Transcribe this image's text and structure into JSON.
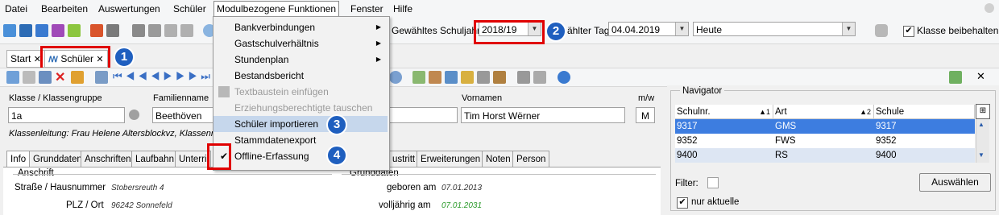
{
  "menu": {
    "items": [
      "Datei",
      "Bearbeiten",
      "Auswertungen",
      "Schüler",
      "Modulbezogene Funktionen",
      "Fenster",
      "Hilfe"
    ]
  },
  "toolbar": {
    "schoolyear_label": "Gewähltes Schuljahr",
    "schoolyear_value": "2018/19",
    "day_label": "ählter Tag",
    "day_value": "04.04.2019",
    "heute_value": "Heute",
    "klasse_checkbox_label": "Klasse beibehalten"
  },
  "doc_tabs": [
    {
      "label": "Start"
    },
    {
      "label": "Schüler"
    }
  ],
  "dropdown": {
    "items": [
      {
        "label": "Bankverbindungen",
        "submenu": true,
        "disabled": false
      },
      {
        "label": "Gastschulverhältnis",
        "submenu": true,
        "disabled": false
      },
      {
        "label": "Stundenplan",
        "submenu": true,
        "disabled": false
      },
      {
        "label": "Bestandsbericht",
        "submenu": false,
        "disabled": false
      },
      {
        "label": "Textbaustein einfügen",
        "submenu": false,
        "disabled": true
      },
      {
        "label": "Erziehungsberechtigte tauschen",
        "submenu": false,
        "disabled": true
      },
      {
        "label": "Schüler importieren",
        "submenu": false,
        "disabled": false,
        "highlighted": true
      },
      {
        "label": "Stammdatenexport",
        "submenu": false,
        "disabled": false
      },
      {
        "label": "Offline-Erfassung",
        "submenu": false,
        "disabled": false,
        "checked": true
      }
    ]
  },
  "badges": [
    "1",
    "2",
    "3",
    "4"
  ],
  "student": {
    "klasse_label": "Klasse / Klassengruppe",
    "klasse_value": "1a",
    "familienname_label": "Familienname",
    "familienname_value": "Beethöven",
    "vornamen_label": "Vornamen",
    "vornamen_value": "Tim Horst Wërner",
    "mw_label": "m/w",
    "mw_value": "M",
    "klassenleitung": "Klassenleitung: Frau Helene Altersblockvz, Klassenraum"
  },
  "subtabs": [
    "Info",
    "Grunddaten",
    "Anschriften",
    "Laufbahn",
    "Unterri",
    "ustritt",
    "Erweiterungen",
    "Noten",
    "Person"
  ],
  "info": {
    "anschrift_title": "Anschrift",
    "grunddaten_title": "Grunddaten",
    "strasse_label": "Straße / Hausnummer",
    "strasse_value": "Stobersreuth 4",
    "plz_label": "PLZ / Ort",
    "plz_value": "96242 Sonnefeld",
    "geboren_label": "geboren am",
    "geboren_value": "07.01.2013",
    "volljaehrig_label": "volljährig am",
    "volljaehrig_value": "07.01.2031"
  },
  "navigator": {
    "title": "Navigator",
    "columns": [
      "Schulnr.",
      "Art",
      "Schule"
    ],
    "sort_markers": [
      "1",
      "2"
    ],
    "rows": [
      {
        "schulnr": "9317",
        "art": "GMS",
        "schule": "9317"
      },
      {
        "schulnr": "9352",
        "art": "FWS",
        "schule": "9352"
      },
      {
        "schulnr": "9400",
        "art": "RS",
        "schule": "9400"
      }
    ],
    "filter_label": "Filter:",
    "auswaehlen_label": "Auswählen",
    "nur_aktuelle_label": "nur aktuelle"
  },
  "colors": {
    "highlight_row": "#3d7de0",
    "menu_highlight": "#c6d7ec",
    "annotation_red": "#e00000",
    "badge_blue": "#1f5fbf"
  }
}
